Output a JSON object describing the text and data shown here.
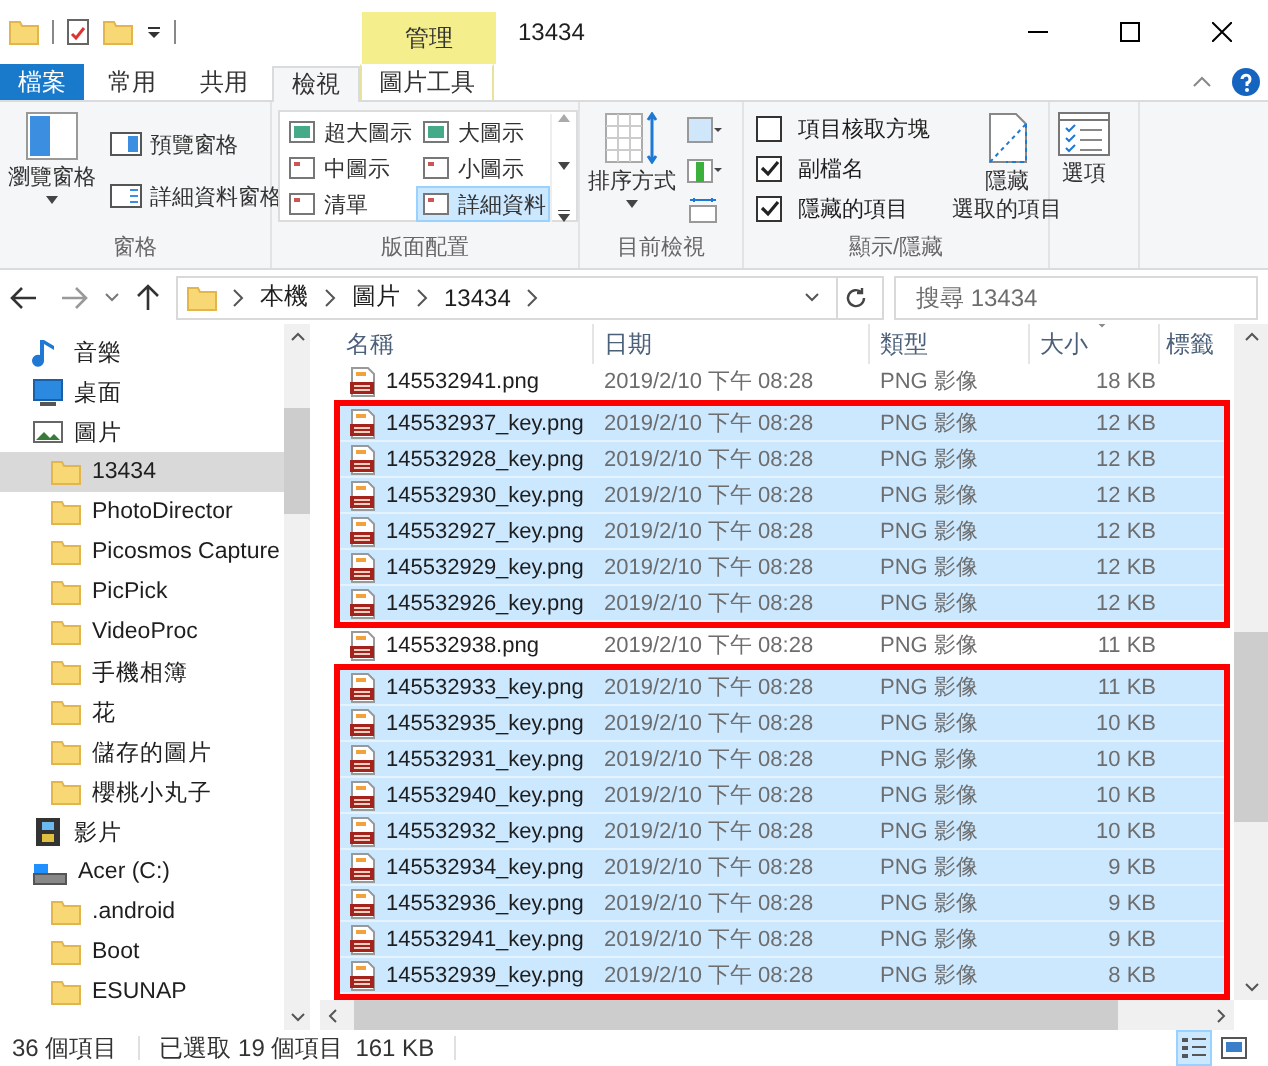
{
  "window": {
    "title": "13434",
    "context_tab": "管理"
  },
  "ribbon_tabs": [
    {
      "label": "檔案",
      "kind": "file",
      "selected": false
    },
    {
      "label": "常用",
      "kind": "normal",
      "selected": false
    },
    {
      "label": "共用",
      "kind": "normal",
      "selected": false
    },
    {
      "label": "檢視",
      "kind": "normal",
      "selected": true
    },
    {
      "label": "圖片工具",
      "kind": "context",
      "selected": false
    }
  ],
  "ribbon": {
    "panes": {
      "title": "窗格",
      "navigation_pane": "瀏覽窗格",
      "preview_pane": "預覽窗格",
      "details_pane": "詳細資料窗格"
    },
    "layout": {
      "title": "版面配置",
      "options": [
        {
          "label": "超大圖示",
          "selected": false
        },
        {
          "label": "大圖示",
          "selected": false
        },
        {
          "label": "中圖示",
          "selected": false
        },
        {
          "label": "小圖示",
          "selected": false
        },
        {
          "label": "清單",
          "selected": false
        },
        {
          "label": "詳細資料",
          "selected": true
        }
      ]
    },
    "current_view": {
      "title": "目前檢視",
      "sort_by": "排序方式"
    },
    "show_hide": {
      "title": "顯示/隱藏",
      "checkboxes": [
        {
          "label": "項目核取方塊",
          "checked": false
        },
        {
          "label": "副檔名",
          "checked": true
        },
        {
          "label": "隱藏的項目",
          "checked": true
        }
      ],
      "hide_selected": [
        "隱藏",
        "選取的項目"
      ]
    },
    "options": {
      "label": "選項"
    }
  },
  "address_bar": {
    "path": [
      "本機",
      "圖片",
      "13434"
    ]
  },
  "search": {
    "placeholder": "搜尋 13434"
  },
  "navigation": [
    {
      "label": "音樂",
      "kind": "music",
      "selected": false
    },
    {
      "label": "桌面",
      "kind": "desktop",
      "selected": false
    },
    {
      "label": "圖片",
      "kind": "pictures",
      "selected": false,
      "children": [
        {
          "label": "13434",
          "kind": "folder",
          "selected": true
        },
        {
          "label": "PhotoDirector",
          "kind": "folder",
          "selected": false
        },
        {
          "label": "Picosmos Capture",
          "kind": "folder",
          "selected": false
        },
        {
          "label": "PicPick",
          "kind": "folder",
          "selected": false
        },
        {
          "label": "VideoProc",
          "kind": "folder",
          "selected": false
        },
        {
          "label": "手機相簿",
          "kind": "folder",
          "selected": false
        },
        {
          "label": "花",
          "kind": "folder",
          "selected": false
        },
        {
          "label": "儲存的圖片",
          "kind": "folder",
          "selected": false
        },
        {
          "label": "櫻桃小丸子",
          "kind": "folder",
          "selected": false
        }
      ]
    },
    {
      "label": "影片",
      "kind": "videos",
      "selected": false
    },
    {
      "label": "Acer (C:)",
      "kind": "drive",
      "selected": false,
      "children": [
        {
          "label": ".android",
          "kind": "folder",
          "selected": false
        },
        {
          "label": "Boot",
          "kind": "folder",
          "selected": false
        },
        {
          "label": "ESUNAP",
          "kind": "folder",
          "selected": false
        }
      ]
    }
  ],
  "file_list": {
    "columns": [
      {
        "label": "名稱",
        "sorted": false
      },
      {
        "label": "日期",
        "sorted": false
      },
      {
        "label": "類型",
        "sorted": false
      },
      {
        "label": "大小",
        "sorted": true
      },
      {
        "label": "標籤",
        "sorted": false
      }
    ],
    "row_groups": [
      {
        "framed": false,
        "rows": [
          {
            "name": "145532941.png",
            "date": "2019/2/10 下午 08:28",
            "type": "PNG 影像",
            "size": "18 KB",
            "selected": false
          }
        ]
      },
      {
        "framed": true,
        "rows": [
          {
            "name": "145532937_key.png",
            "date": "2019/2/10 下午 08:28",
            "type": "PNG 影像",
            "size": "12 KB",
            "selected": true
          },
          {
            "name": "145532928_key.png",
            "date": "2019/2/10 下午 08:28",
            "type": "PNG 影像",
            "size": "12 KB",
            "selected": true
          },
          {
            "name": "145532930_key.png",
            "date": "2019/2/10 下午 08:28",
            "type": "PNG 影像",
            "size": "12 KB",
            "selected": true
          },
          {
            "name": "145532927_key.png",
            "date": "2019/2/10 下午 08:28",
            "type": "PNG 影像",
            "size": "12 KB",
            "selected": true
          },
          {
            "name": "145532929_key.png",
            "date": "2019/2/10 下午 08:28",
            "type": "PNG 影像",
            "size": "12 KB",
            "selected": true
          },
          {
            "name": "145532926_key.png",
            "date": "2019/2/10 下午 08:28",
            "type": "PNG 影像",
            "size": "12 KB",
            "selected": true
          }
        ]
      },
      {
        "framed": false,
        "rows": [
          {
            "name": "145532938.png",
            "date": "2019/2/10 下午 08:28",
            "type": "PNG 影像",
            "size": "11 KB",
            "selected": false
          }
        ]
      },
      {
        "framed": true,
        "rows": [
          {
            "name": "145532933_key.png",
            "date": "2019/2/10 下午 08:28",
            "type": "PNG 影像",
            "size": "11 KB",
            "selected": true
          },
          {
            "name": "145532935_key.png",
            "date": "2019/2/10 下午 08:28",
            "type": "PNG 影像",
            "size": "10 KB",
            "selected": true
          },
          {
            "name": "145532931_key.png",
            "date": "2019/2/10 下午 08:28",
            "type": "PNG 影像",
            "size": "10 KB",
            "selected": true
          },
          {
            "name": "145532940_key.png",
            "date": "2019/2/10 下午 08:28",
            "type": "PNG 影像",
            "size": "10 KB",
            "selected": true
          },
          {
            "name": "145532932_key.png",
            "date": "2019/2/10 下午 08:28",
            "type": "PNG 影像",
            "size": "10 KB",
            "selected": true
          },
          {
            "name": "145532934_key.png",
            "date": "2019/2/10 下午 08:28",
            "type": "PNG 影像",
            "size": "9 KB",
            "selected": true
          },
          {
            "name": "145532936_key.png",
            "date": "2019/2/10 下午 08:28",
            "type": "PNG 影像",
            "size": "9 KB",
            "selected": true
          },
          {
            "name": "145532941_key.png",
            "date": "2019/2/10 下午 08:28",
            "type": "PNG 影像",
            "size": "9 KB",
            "selected": true
          },
          {
            "name": "145532939_key.png",
            "date": "2019/2/10 下午 08:28",
            "type": "PNG 影像",
            "size": "8 KB",
            "selected": true
          }
        ]
      }
    ]
  },
  "status_bar": {
    "item_count": "36 個項目",
    "selection": "已選取 19 個項目",
    "selection_size": "161 KB",
    "views": [
      {
        "kind": "details",
        "selected": true
      },
      {
        "kind": "large-icons",
        "selected": false
      }
    ]
  }
}
